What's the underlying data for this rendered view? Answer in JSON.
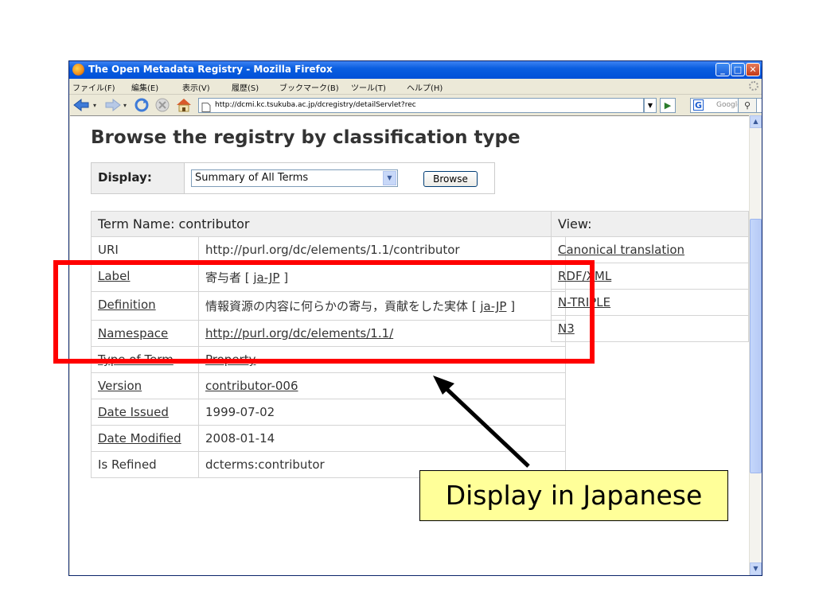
{
  "window": {
    "title": "The Open Metadata Registry - Mozilla Firefox",
    "controls": {
      "minimize": "_",
      "maximize": "□",
      "close": "✕"
    }
  },
  "menubar": {
    "items": [
      "ファイル(F)",
      "編集(E)",
      "表示(V)",
      "履歴(S)",
      "ブックマーク(B)",
      "ツール(T)",
      "ヘルプ(H)"
    ]
  },
  "navbar": {
    "url": "http://dcmi.kc.tsukuba.ac.jp/dcregistry/detailServlet?rec",
    "search_placeholder": "Google",
    "search_engine_letter": "G",
    "icons": [
      "back-icon",
      "forward-icon",
      "reload-icon",
      "stop-icon",
      "home-icon",
      "page-icon",
      "go-icon",
      "search-icon"
    ]
  },
  "page": {
    "heading": "Browse the registry by classification type",
    "display_label": "Display:",
    "display_selected": "Summary of All Terms",
    "browse_button": "Browse",
    "term_header": "Term Name: contributor",
    "rows": [
      {
        "label": "URI",
        "label_is_link": false,
        "value": "http://purl.org/dc/elements/1.1/contributor",
        "value_is_link": false,
        "lang": ""
      },
      {
        "label": "Label",
        "label_is_link": true,
        "value": "寄与者 [ ",
        "value_is_link": false,
        "lang": "ja-JP",
        "suffix": " ]"
      },
      {
        "label": "Definition",
        "label_is_link": true,
        "value": "情報資源の内容に何らかの寄与，貢献をした実体 [ ",
        "value_is_link": false,
        "lang": "ja-JP",
        "suffix": " ]"
      },
      {
        "label": "Namespace",
        "label_is_link": true,
        "value": "http://purl.org/dc/elements/1.1/",
        "value_is_link": true,
        "lang": ""
      },
      {
        "label": "Type of Term",
        "label_is_link": true,
        "value": "Property",
        "value_is_link": true,
        "lang": ""
      },
      {
        "label": "Version",
        "label_is_link": true,
        "value": "contributor-006",
        "value_is_link": true,
        "lang": ""
      },
      {
        "label": "Date Issued",
        "label_is_link": true,
        "value": "1999-07-02",
        "value_is_link": false,
        "lang": ""
      },
      {
        "label": "Date Modified",
        "label_is_link": true,
        "value": "2008-01-14",
        "value_is_link": false,
        "lang": ""
      },
      {
        "label": "Is Refined",
        "label_is_link": false,
        "value": "dcterms:contributor",
        "value_is_link": false,
        "lang": ""
      }
    ],
    "view_header": "View:",
    "view_links": [
      "Canonical translation",
      "RDF/XML",
      "N-TRIPLE",
      "N3"
    ]
  },
  "annotation": {
    "callout_text": "Display in Japanese",
    "highlight_color": "#FF0000",
    "callout_color": "#FFFF99"
  }
}
